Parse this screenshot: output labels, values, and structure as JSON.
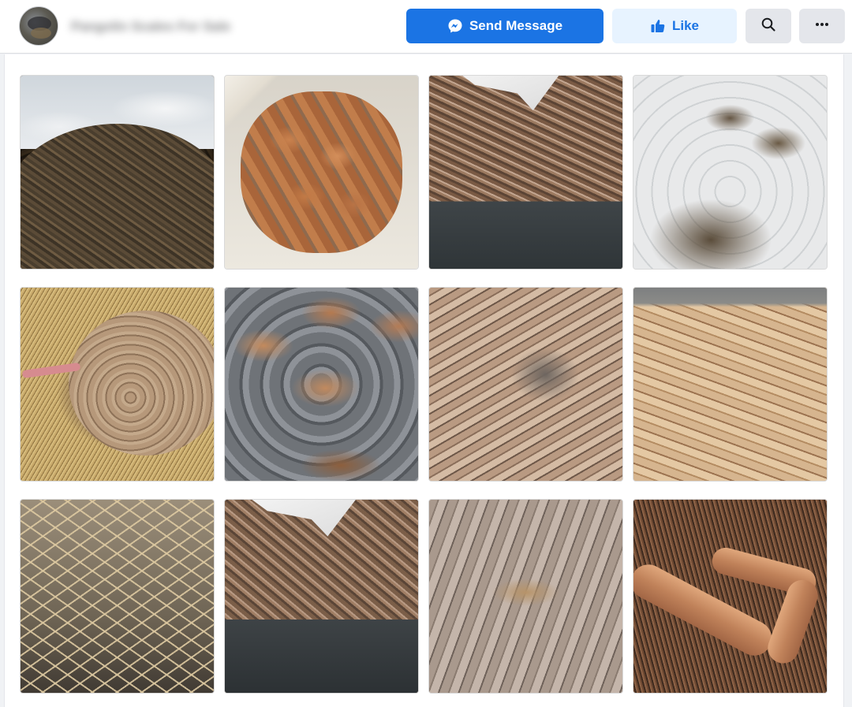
{
  "header": {
    "page_name": "Pangolin Scales For Sale",
    "send_message_label": "Send Message",
    "like_label": "Like"
  },
  "icons": {
    "avatar": "profile-avatar",
    "send_message": "messenger-icon",
    "like": "thumbs-up-icon",
    "search": "search-icon",
    "more": "more-horizontal-icon"
  },
  "colors": {
    "primary": "#1b74e4",
    "like_bg": "#e7f3ff",
    "icon_btn_bg": "#e4e6eb",
    "page_bg": "#f0f2f5"
  },
  "photos": [
    {
      "name": "photo-scales-pile-bags"
    },
    {
      "name": "photo-scales-in-sack"
    },
    {
      "name": "photo-scales-scoop"
    },
    {
      "name": "photo-many-sacks"
    },
    {
      "name": "photo-pangolin"
    },
    {
      "name": "photo-grey-sacks"
    },
    {
      "name": "photo-scales-closeup"
    },
    {
      "name": "photo-scales-pile-tan"
    },
    {
      "name": "photo-pangolin-skin"
    },
    {
      "name": "photo-scales-scoop-2"
    },
    {
      "name": "photo-scales-grey"
    },
    {
      "name": "photo-tusks-and-scales"
    }
  ]
}
